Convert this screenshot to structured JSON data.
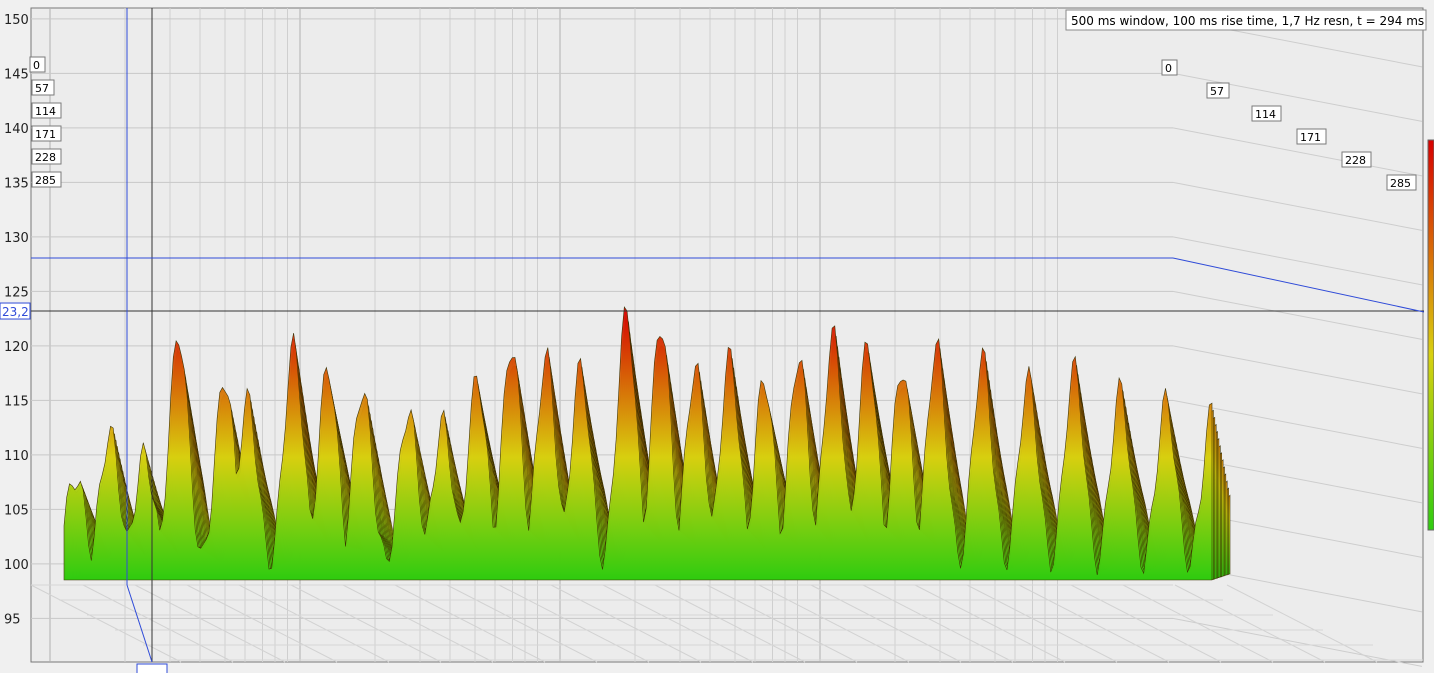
{
  "chart_data": {
    "type": "waterfall",
    "title": "",
    "info": "500 ms window, 100 ms rise time,  1,7 Hz resn, t = 294 ms",
    "ylabel": "",
    "xlabel": "",
    "ylim": [
      91,
      151
    ],
    "y_ticks": [
      95,
      100,
      105,
      110,
      115,
      120,
      125,
      130,
      135,
      140,
      145,
      150
    ],
    "time_labels_ms": [
      "0",
      "57",
      "114",
      "171",
      "228",
      "285"
    ],
    "cursor_readout": "23,2",
    "cursor_level": 123.2,
    "grid": true,
    "colormap": [
      "#2fcc10",
      "#e0d010",
      "#d70000"
    ],
    "peaks": [
      {
        "x": 0.01,
        "level": 108
      },
      {
        "x": 0.04,
        "level": 112
      },
      {
        "x": 0.07,
        "level": 110
      },
      {
        "x": 0.1,
        "level": 121
      },
      {
        "x": 0.14,
        "level": 117
      },
      {
        "x": 0.16,
        "level": 115
      },
      {
        "x": 0.2,
        "level": 120
      },
      {
        "x": 0.23,
        "level": 118
      },
      {
        "x": 0.26,
        "level": 116
      },
      {
        "x": 0.3,
        "level": 114
      },
      {
        "x": 0.33,
        "level": 113
      },
      {
        "x": 0.36,
        "level": 117
      },
      {
        "x": 0.39,
        "level": 120
      },
      {
        "x": 0.42,
        "level": 119
      },
      {
        "x": 0.45,
        "level": 118
      },
      {
        "x": 0.49,
        "level": 123
      },
      {
        "x": 0.52,
        "level": 122
      },
      {
        "x": 0.55,
        "level": 118
      },
      {
        "x": 0.58,
        "level": 119
      },
      {
        "x": 0.61,
        "level": 117
      },
      {
        "x": 0.64,
        "level": 119
      },
      {
        "x": 0.67,
        "level": 121
      },
      {
        "x": 0.7,
        "level": 120
      },
      {
        "x": 0.73,
        "level": 118
      },
      {
        "x": 0.76,
        "level": 120
      },
      {
        "x": 0.8,
        "level": 119
      },
      {
        "x": 0.84,
        "level": 117
      },
      {
        "x": 0.88,
        "level": 118
      },
      {
        "x": 0.92,
        "level": 116
      },
      {
        "x": 0.96,
        "level": 115
      },
      {
        "x": 1.0,
        "level": 114
      }
    ]
  }
}
